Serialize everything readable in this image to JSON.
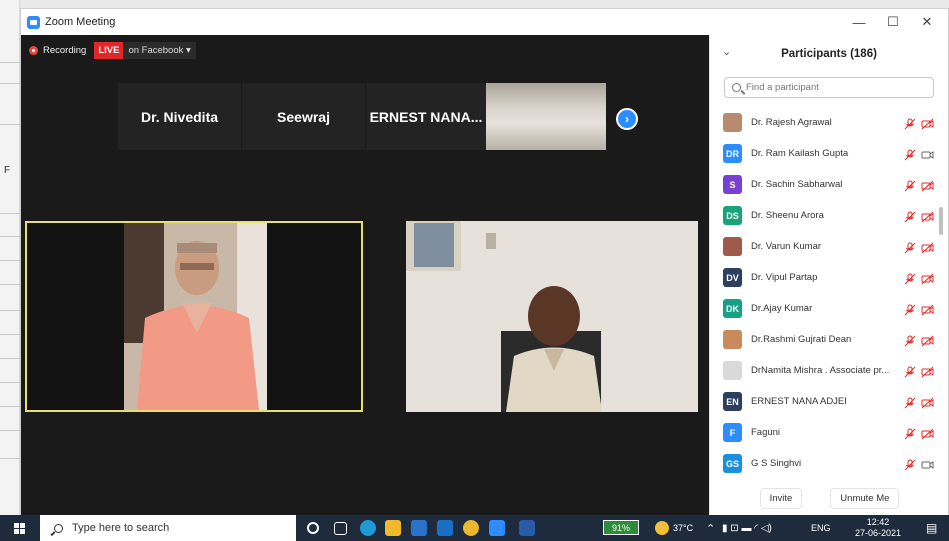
{
  "window": {
    "title": "Zoom Meeting"
  },
  "background_app": {
    "fragment": "F"
  },
  "recording": {
    "label": "Recording",
    "live": "LIVE",
    "destination": "on Facebook"
  },
  "thumbnails": [
    {
      "name": "Dr. Nivedita"
    },
    {
      "name": "Seewraj"
    },
    {
      "name": "ERNEST  NANA..."
    }
  ],
  "participants_panel": {
    "title": "Participants (186)",
    "search_placeholder": "Find a participant",
    "participants": [
      {
        "name": "Dr. Rajesh Agrawal",
        "initials": "",
        "avatar_color": "#b98b6e",
        "photo": true,
        "mic": "muted",
        "cam": "off"
      },
      {
        "name": "Dr. Ram Kailash Gupta",
        "initials": "DR",
        "avatar_color": "#2d8cff",
        "photo": false,
        "mic": "muted",
        "cam": "on"
      },
      {
        "name": "Dr. Sachin Sabharwal",
        "initials": "S",
        "avatar_color": "#7a3fd6",
        "photo": false,
        "mic": "muted",
        "cam": "off"
      },
      {
        "name": "Dr. Sheenu Arora",
        "initials": "DS",
        "avatar_color": "#1aa37a",
        "photo": false,
        "mic": "muted",
        "cam": "off"
      },
      {
        "name": "Dr. Varun Kumar",
        "initials": "",
        "avatar_color": "#a05a4a",
        "photo": true,
        "mic": "muted",
        "cam": "off"
      },
      {
        "name": "Dr. Vipul Partap",
        "initials": "DV",
        "avatar_color": "#2c3f5e",
        "photo": false,
        "mic": "muted",
        "cam": "off"
      },
      {
        "name": "Dr.Ajay Kumar",
        "initials": "DK",
        "avatar_color": "#16a085",
        "photo": false,
        "mic": "muted",
        "cam": "off"
      },
      {
        "name": "Dr.Rashmi Gujrati Dean",
        "initials": "",
        "avatar_color": "#c98a5c",
        "photo": true,
        "mic": "muted",
        "cam": "off"
      },
      {
        "name": "DrNamita Mishra . Associate pr...",
        "initials": "",
        "avatar_color": "#d9d9d9",
        "photo": true,
        "mic": "muted",
        "cam": "off"
      },
      {
        "name": "ERNEST NANA ADJEI",
        "initials": "EN",
        "avatar_color": "#2c3f5e",
        "photo": false,
        "mic": "muted",
        "cam": "off"
      },
      {
        "name": "Faguni",
        "initials": "F",
        "avatar_color": "#2d8cff",
        "photo": false,
        "mic": "muted",
        "cam": "off"
      },
      {
        "name": "G S Singhvi",
        "initials": "GS",
        "avatar_color": "#1a8fe0",
        "photo": false,
        "mic": "muted",
        "cam": "on"
      }
    ],
    "buttons": {
      "invite": "Invite",
      "unmute": "Unmute Me"
    }
  },
  "taskbar": {
    "search_placeholder": "Type here to search",
    "battery": "91%",
    "temperature": "37°C",
    "language": "ENG",
    "time": "12:42",
    "date": "27-06-2021"
  },
  "colors": {
    "accent": "#2d8cff",
    "live": "#e02828",
    "active_speaker": "#e7e06b"
  }
}
